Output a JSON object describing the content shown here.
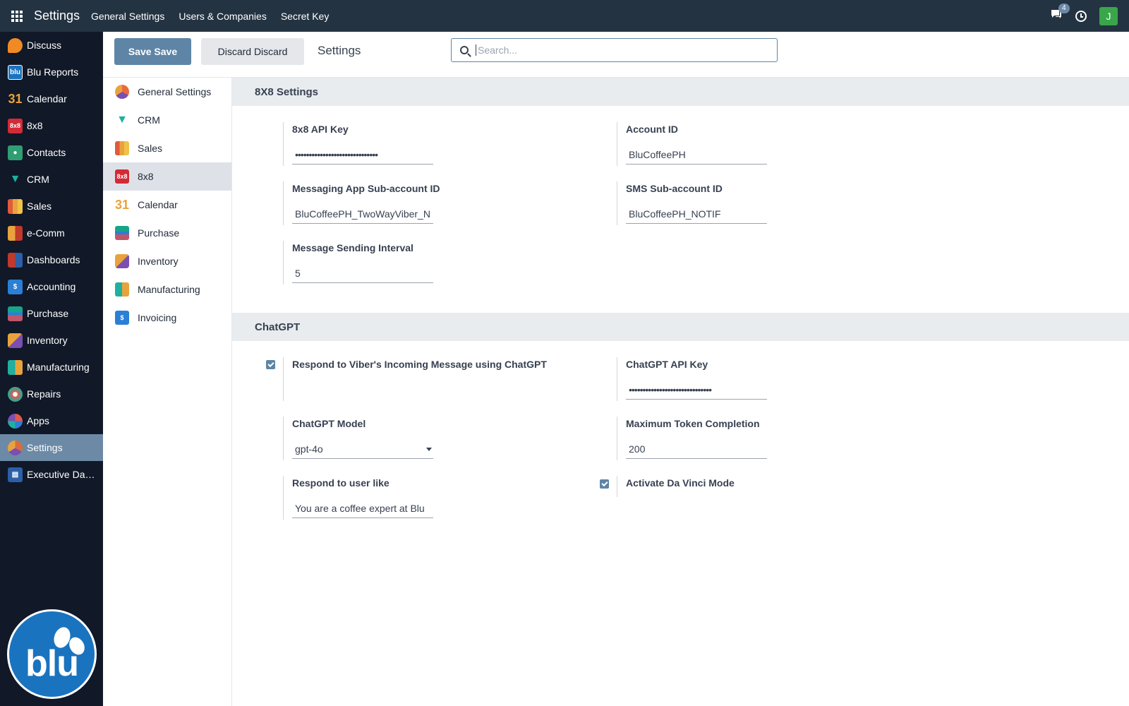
{
  "topbar": {
    "brand": "Settings",
    "menu": [
      "General Settings",
      "Users & Companies",
      "Secret Key"
    ],
    "chat_count": "4",
    "avatar_initial": "J"
  },
  "apps": [
    {
      "label": "Discuss",
      "icon": "discuss-icon",
      "color": "#f08a24"
    },
    {
      "label": "Blu Reports",
      "icon": "blu-reports-icon",
      "color": "#1a73bf"
    },
    {
      "label": "Calendar",
      "icon": "calendar-icon",
      "color": "#e8a33d"
    },
    {
      "label": "8x8",
      "icon": "8x8-icon",
      "color": "#d42a36"
    },
    {
      "label": "Contacts",
      "icon": "contacts-icon",
      "color": "#2f9e73"
    },
    {
      "label": "CRM",
      "icon": "crm-icon",
      "color": "#1fb0a0"
    },
    {
      "label": "Sales",
      "icon": "sales-icon",
      "color": "#e05a3c"
    },
    {
      "label": "e-Comm",
      "icon": "ecomm-icon",
      "color": "#e8a33d"
    },
    {
      "label": "Dashboards",
      "icon": "dashboards-icon",
      "color": "#c0392b"
    },
    {
      "label": "Accounting",
      "icon": "accounting-icon",
      "color": "#2b7fd4"
    },
    {
      "label": "Purchase",
      "icon": "purchase-icon",
      "color": "#16a58b"
    },
    {
      "label": "Inventory",
      "icon": "inventory-icon",
      "color": "#c0566a"
    },
    {
      "label": "Manufacturing",
      "icon": "manufacturing-icon",
      "color": "#1fb0a0"
    },
    {
      "label": "Repairs",
      "icon": "repairs-icon",
      "color": "#e0594b"
    },
    {
      "label": "Apps",
      "icon": "apps-icon",
      "color": "#7b4fb0"
    },
    {
      "label": "Settings",
      "icon": "settings-icon",
      "color": "#d96c3c"
    },
    {
      "label": "Executive Das...",
      "icon": "executive-dashboard-icon",
      "color": "#2b5fa8"
    }
  ],
  "control": {
    "save_label": "Save Save",
    "discard_label": "Discard Discard",
    "title": "Settings",
    "search_placeholder": "Search..."
  },
  "settings_nav": [
    {
      "label": "General Settings",
      "icon": "general-settings-icon",
      "color": "#e86a3c"
    },
    {
      "label": "CRM",
      "icon": "crm-icon",
      "color": "#1fb0a0"
    },
    {
      "label": "Sales",
      "icon": "sales-icon",
      "color": "#e05a3c"
    },
    {
      "label": "8x8",
      "icon": "8x8-icon",
      "color": "#d42a36"
    },
    {
      "label": "Calendar",
      "icon": "calendar-icon",
      "color": "#e8a33d"
    },
    {
      "label": "Purchase",
      "icon": "purchase-icon",
      "color": "#16a58b"
    },
    {
      "label": "Inventory",
      "icon": "inventory-icon",
      "color": "#c0566a"
    },
    {
      "label": "Manufacturing",
      "icon": "manufacturing-icon",
      "color": "#1fb0a0"
    },
    {
      "label": "Invoicing",
      "icon": "invoicing-icon",
      "color": "#2b7fd4"
    }
  ],
  "section_8x8": {
    "title": "8X8 Settings",
    "api_key_label": "8x8 API Key",
    "api_key_value": "••••••••••••••••••••••••••••••",
    "account_id_label": "Account ID",
    "account_id_value": "BluCoffeePH",
    "messaging_sub_label": "Messaging App Sub-account ID",
    "messaging_sub_value": "BluCoffeePH_TwoWayViber_N",
    "sms_sub_label": "SMS Sub-account ID",
    "sms_sub_value": "BluCoffeePH_NOTIF",
    "interval_label": "Message Sending Interval",
    "interval_value": "5"
  },
  "section_chatgpt": {
    "title": "ChatGPT",
    "respond_viber_label": "Respond to Viber's Incoming Message using ChatGPT",
    "respond_viber_checked": true,
    "api_key_label": "ChatGPT API Key",
    "api_key_value": "••••••••••••••••••••••••••••••",
    "model_label": "ChatGPT Model",
    "model_value": "gpt-4o",
    "max_token_label": "Maximum Token Completion",
    "max_token_value": "200",
    "respond_like_label": "Respond to user like",
    "respond_like_value": "You are a coffee expert at Blu",
    "da_vinci_label": "Activate Da Vinci Mode",
    "da_vinci_checked": true
  },
  "colors": {
    "topbar": "#243342",
    "appbar": "#111827",
    "accent": "#5e85a5",
    "section_bg": "#e9ecef",
    "active_nav": "#dee2e8",
    "avatar": "#3aa64a",
    "blu_logo": "#1a73bf"
  }
}
